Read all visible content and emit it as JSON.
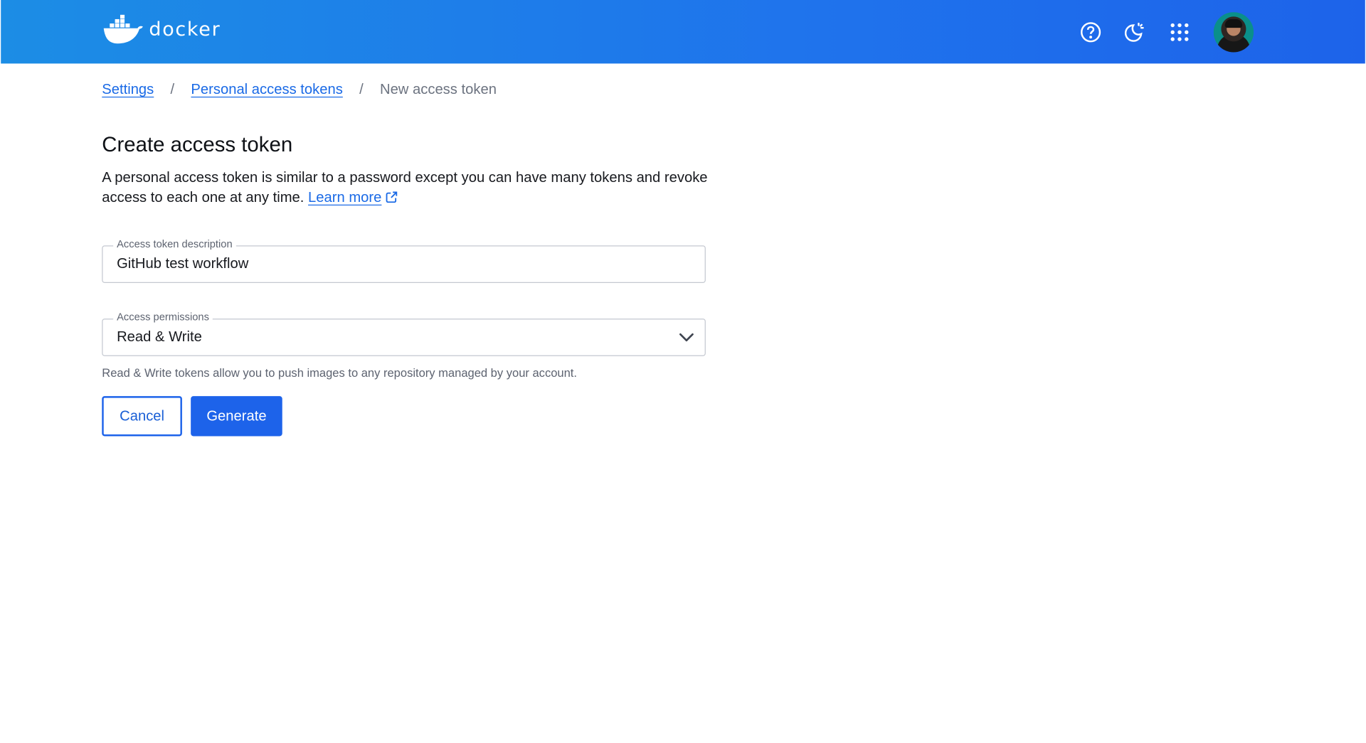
{
  "header": {
    "logo_text": "docker",
    "icons": [
      "help-icon",
      "theme-toggle-icon",
      "apps-grid-icon",
      "avatar"
    ],
    "gradient_start": "#1c8de5",
    "gradient_end": "#1d63ea"
  },
  "breadcrumb": {
    "items": [
      {
        "label": "Settings",
        "link": true
      },
      {
        "label": "Personal access tokens",
        "link": true
      },
      {
        "label": "New access token",
        "link": false
      }
    ],
    "separator": "/"
  },
  "main": {
    "title": "Create access token",
    "description": "A personal access token is similar to a password except you can have many tokens and revoke access to each one at any time.",
    "learn_more": "Learn more",
    "description_field": {
      "label": "Access token description",
      "value": "GitHub test workflow"
    },
    "permissions_field": {
      "label": "Access permissions",
      "value": "Read & Write",
      "helper": "Read & Write tokens allow you to push images to any repository managed by your account."
    },
    "buttons": {
      "cancel": "Cancel",
      "generate": "Generate"
    }
  },
  "colors": {
    "accent": "#1d63ea",
    "link": "#1a6ae6"
  }
}
